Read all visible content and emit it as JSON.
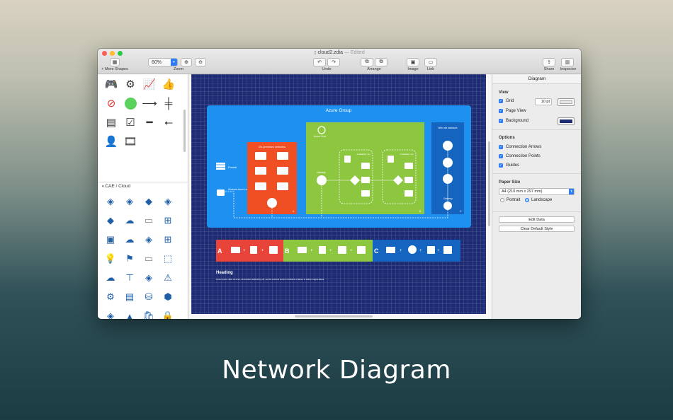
{
  "window": {
    "title": "cloud2.zdia",
    "status": "— Edited"
  },
  "toolbar": {
    "more_shapes": "+ More Shapes",
    "zoom_value": "60%",
    "zoom_label": "Zoom",
    "undo_label": "Undo",
    "arrange_label": "Arrange",
    "image_label": "Image",
    "link_label": "Link",
    "share_label": "Share",
    "inspector_label": "Inspector"
  },
  "library": {
    "section_title": "CAE / Cloud"
  },
  "diagram": {
    "group_title": "Azure Group",
    "onprem_title": "On-premises networks",
    "vnet_title": "Azure Vnet",
    "web_title": "Web role instances",
    "firewall_label": "Firewall",
    "lb_label": "Windows Azure Load Balancer",
    "gateway_label": "Gateway",
    "avail_set_label": "Availability set",
    "tag_a": "A",
    "tag_b": "B",
    "tag_c": "C",
    "heading": "Heading",
    "body_text": "Lorem ipsum dolor sit amet, consectetur adipisicing elit, sed do eiusmod tempor incididunt ut labore et dolore magna aliqua."
  },
  "inspector": {
    "title": "Diagram",
    "view_section": "View",
    "grid_label": "Grid",
    "grid_size": "10 pt",
    "page_view_label": "Page View",
    "background_label": "Background",
    "options_section": "Options",
    "connection_arrows_label": "Connection Arrows",
    "connection_points_label": "Connection Points",
    "guides_label": "Guides",
    "paper_section": "Paper Size",
    "paper_size": "A4 (210 mm x 297 mm)",
    "portrait_label": "Portrait",
    "landscape_label": "Landscape",
    "edit_data_button": "Edit Data",
    "clear_style_button": "Clear Default Style"
  },
  "colors": {
    "group_blue": "#1e90f0",
    "onprem_red": "#f04e23",
    "vnet_green": "#8dc63f",
    "web_blue": "#1565c0",
    "page_bg": "#1e2c74"
  },
  "caption": "Network Diagram"
}
